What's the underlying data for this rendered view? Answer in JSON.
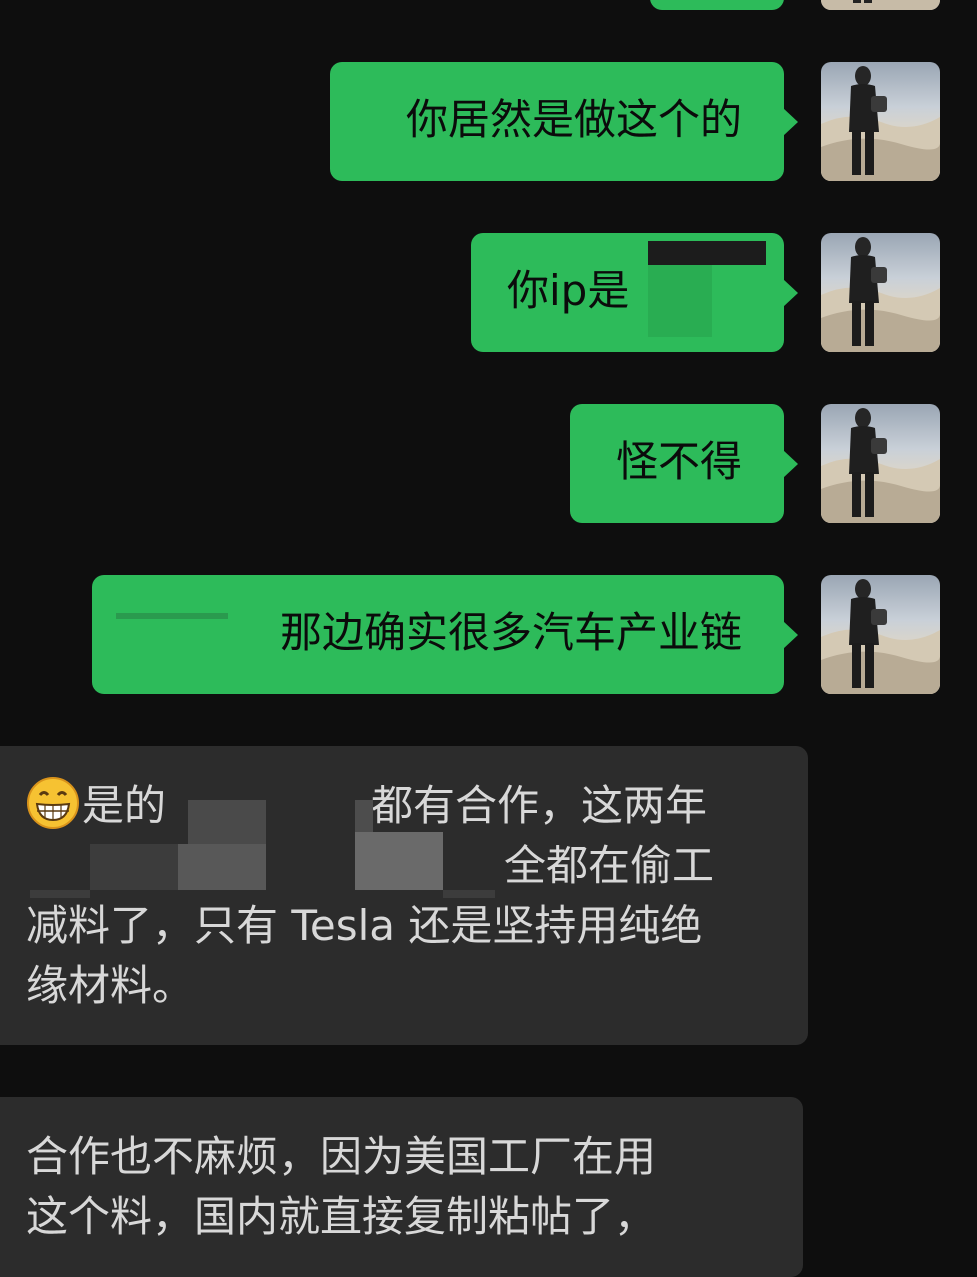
{
  "messages_out": [
    {
      "text": "你居然是做这个的"
    },
    {
      "text": "你ip是"
    },
    {
      "text": "怪不得"
    },
    {
      "text": "那边确实很多汽车产业链"
    }
  ],
  "messages_in": [
    {
      "line1_a": "是的",
      "line1_b": "都有合作，这两年",
      "line2": "全都在偷工",
      "line3": "减料了，只有 Tesla 还是坚持用纯绝",
      "line4": "缘材料。",
      "emoji": "grinning-face-emoji"
    },
    {
      "line1": "合作也不麻烦，因为美国工厂在用",
      "line2": "这个料，国内就直接复制粘帖了，"
    }
  ],
  "colors": {
    "background": "#0e0e0e",
    "sent_bubble": "#2dbb5a",
    "received_bubble": "#2c2c2c"
  },
  "icons": {
    "avatar": "person-in-desert-avatar"
  }
}
